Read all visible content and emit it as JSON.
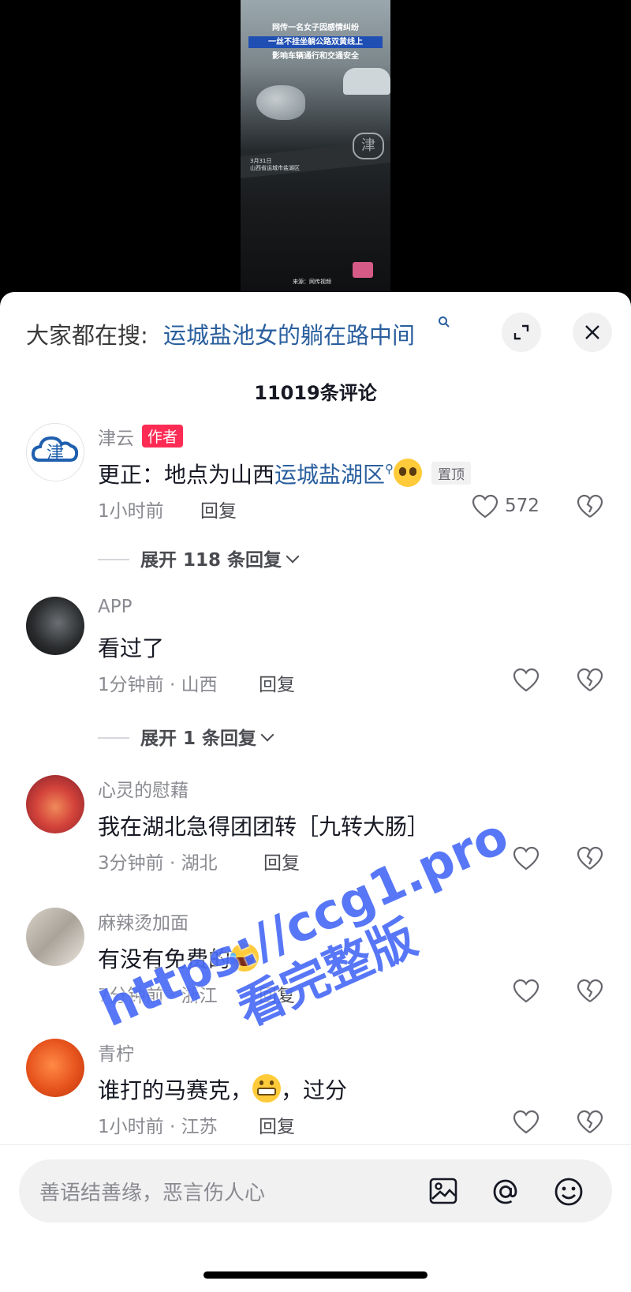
{
  "video": {
    "caption_line1": "网传一名女子因感情纠纷",
    "caption_line2": "一丝不挂坐躺公路双黄线上",
    "caption_line3": "影响车辆通行和交通安全",
    "date_label": "3月31日",
    "location_label": "山西省运城市盐湖区",
    "logo_glyph": "津",
    "source_label": "来源：网传视频"
  },
  "search": {
    "prefix": "大家都在搜:",
    "term": "运城盐池女的躺在路中间",
    "search_icon": "magnifier-icon",
    "expand_icon": "expand-icon",
    "close_icon": "close-icon"
  },
  "comments_header": {
    "count_label": "11019条评论"
  },
  "comments": [
    {
      "username": "津云",
      "author_badge": "作者",
      "text_prefix": "更正：地点为山西",
      "text_link": "运城盐湖区",
      "emoji": "pleading-face-emoji",
      "pin_tag": "置顶",
      "time": "1小时前",
      "reply_label": "回复",
      "like_count": "572",
      "avatar_glyph": "津"
    },
    {
      "username": "APP",
      "text": "看过了",
      "time": "1分钟前 · 山西",
      "reply_label": "回复"
    },
    {
      "username": "心灵的慰藉",
      "text": "我在湖北急得团团转［九转大肠］",
      "time": "3分钟前 · 湖北",
      "reply_label": "回复"
    },
    {
      "username": "麻辣烫加面",
      "text": "有没有免费的",
      "emoji": "rolling-laughing-emoji",
      "time": "7分钟前 · 浙江",
      "reply_label": "回复"
    },
    {
      "username": "青柠",
      "text_prefix": "谁打的马赛克，",
      "emoji": "grinning-face-emoji",
      "text_suffix": "，过分",
      "time": "1小时前 · 江苏",
      "reply_label": "回复"
    }
  ],
  "expand_replies": [
    {
      "label": "展开 118 条回复"
    },
    {
      "label": "展开 1 条回复"
    }
  ],
  "input_bar": {
    "placeholder": "善语结善缘，恶言伤人心",
    "image_icon": "image-icon",
    "mention_icon": "at-mention-icon",
    "emoji_icon": "emoji-smile-icon"
  },
  "watermark": {
    "line1": "https://ccg1.pro",
    "line2": "看完整版"
  },
  "colors": {
    "accent_link": "#2a5f9e",
    "author_badge": "#fe2c55",
    "watermark": "#4a6cf7"
  }
}
